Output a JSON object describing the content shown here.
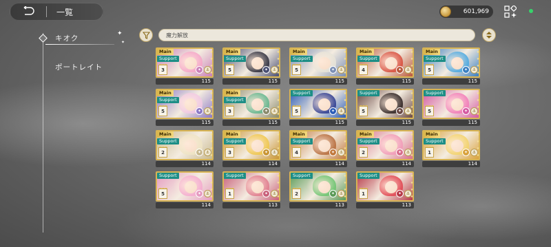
{
  "header": {
    "title": "一覧",
    "coins": "601,969",
    "colors": {
      "status_dot": "#37d36b",
      "coin": "#c99a3e"
    }
  },
  "nav": {
    "items": [
      {
        "label": "キオク",
        "active": true
      },
      {
        "label": "ポートレイト",
        "active": false
      }
    ]
  },
  "filter": {
    "text": "魔力解放"
  },
  "cards": [
    {
      "main": true,
      "support": true,
      "rank": "3",
      "level": "115",
      "hair": "#f6a5c8",
      "bg": "#c97fb8"
    },
    {
      "main": true,
      "support": true,
      "rank": "5",
      "level": "115",
      "hair": "#2c2c3a",
      "bg": "#4a4f73"
    },
    {
      "main": true,
      "support": true,
      "rank": "5",
      "level": "115",
      "hair": "#e8e4d8",
      "bg": "#7b8fb5"
    },
    {
      "main": true,
      "support": true,
      "rank": "4",
      "level": "115",
      "hair": "#d84a3a",
      "bg": "#b9573b"
    },
    {
      "main": true,
      "support": true,
      "rank": "5",
      "level": "115",
      "hair": "#4aa8e0",
      "bg": "#3b7fc0"
    },
    {
      "main": true,
      "support": true,
      "rank": "5",
      "level": "115",
      "hair": "#f2c9e4",
      "bg": "#8b79c6"
    },
    {
      "main": true,
      "support": true,
      "rank": "3",
      "level": "115",
      "hair": "#5fb58c",
      "bg": "#8a8a6c"
    },
    {
      "main": false,
      "support": true,
      "rank": "5",
      "level": "115",
      "hair": "#2b3a8f",
      "bg": "#2c5db8"
    },
    {
      "main": false,
      "support": true,
      "rank": "5",
      "level": "115",
      "hair": "#2a1f1f",
      "bg": "#6b4a45"
    },
    {
      "main": false,
      "support": true,
      "rank": "5",
      "level": "115",
      "hair": "#f27ab8",
      "bg": "#d45aa2"
    },
    {
      "main": true,
      "support": true,
      "rank": "2",
      "level": "114",
      "hair": "#efe4c4",
      "bg": "#c8b990"
    },
    {
      "main": true,
      "support": true,
      "rank": "3",
      "level": "114",
      "hair": "#f0c74a",
      "bg": "#c99534"
    },
    {
      "main": true,
      "support": true,
      "rank": "4",
      "level": "114",
      "hair": "#b56a3a",
      "bg": "#c27a3e"
    },
    {
      "main": true,
      "support": true,
      "rank": "2",
      "level": "114",
      "hair": "#f29ab8",
      "bg": "#d86e8c"
    },
    {
      "main": true,
      "support": true,
      "rank": "1",
      "level": "114",
      "hair": "#f3d36b",
      "bg": "#d9a23d"
    },
    {
      "main": false,
      "support": true,
      "rank": "5",
      "level": "114",
      "hair": "#f4a9cf",
      "bg": "#e59bc0"
    },
    {
      "main": false,
      "support": true,
      "rank": "1",
      "level": "113",
      "hair": "#e07a8c",
      "bg": "#c8607a"
    },
    {
      "main": false,
      "support": true,
      "rank": "2",
      "level": "113",
      "hair": "#6bc46f",
      "bg": "#5a9a57"
    },
    {
      "main": false,
      "support": true,
      "rank": "1",
      "level": "113",
      "hair": "#e2424e",
      "bg": "#b73a48"
    }
  ]
}
